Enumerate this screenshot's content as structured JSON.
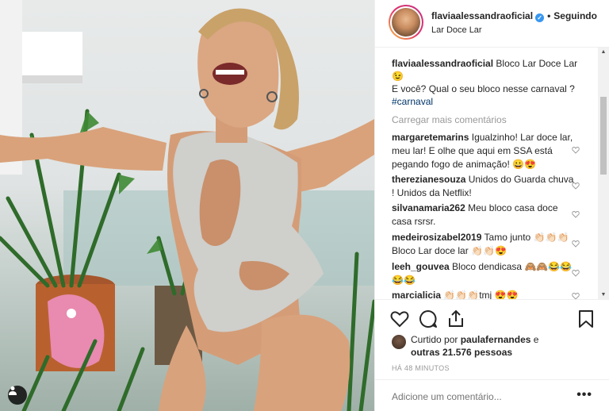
{
  "header": {
    "username": "flaviaalessandraoficial",
    "follow_label": "Seguindo",
    "location": "Lar Doce Lar"
  },
  "caption": {
    "username": "flaviaalessandraoficial",
    "text_line1": "Bloco Lar Doce Lar",
    "emoji": "😉",
    "text_line2": "E você? Qual o seu bloco nesse carnaval ?",
    "hashtag": "#carnaval"
  },
  "load_more_label": "Carregar mais comentários",
  "comments": [
    {
      "user": "margaretemarins",
      "text": "Igualzinho! Lar doce lar, meu lar! E olhe que aqui em SSA está pegando fogo de animação! 😀😍"
    },
    {
      "user": "therezianesouza",
      "text": "Unidos do Guarda chuva ! Unidos da Netflix!"
    },
    {
      "user": "silvanamaria262",
      "text": "Meu bloco casa doce casa rsrsr."
    },
    {
      "user": "medeirosizabel2019",
      "text": "Tamo junto 👏🏻👏🏻👏🏻 Bloco Lar doce lar 👏🏻👏🏻😍"
    },
    {
      "user": "leeh_gouvea",
      "text": "Bloco dendicasa 🙈🙈😂😂😂😂"
    },
    {
      "user": "marcialicia",
      "text": "👏🏻👏🏻👏🏻tmj 😍😍"
    }
  ],
  "likes": {
    "prefix": "Curtido por",
    "liker": "paulafernandes",
    "connector": "e",
    "others": "outras 21.576 pessoas"
  },
  "timestamp": "HÁ 48 MINUTOS",
  "add_comment": {
    "placeholder": "Adicione um comentário..."
  },
  "more_options": "•••",
  "icons": {
    "verified": "verified-badge-icon",
    "like": "heart-icon",
    "comment": "comment-bubble-icon",
    "share": "share-icon",
    "save": "bookmark-icon",
    "user_tags": "user-tag-icon"
  },
  "colors": {
    "accent_blue": "#3897f0",
    "hashtag": "#003569",
    "muted": "#999999",
    "border": "#efefef"
  }
}
